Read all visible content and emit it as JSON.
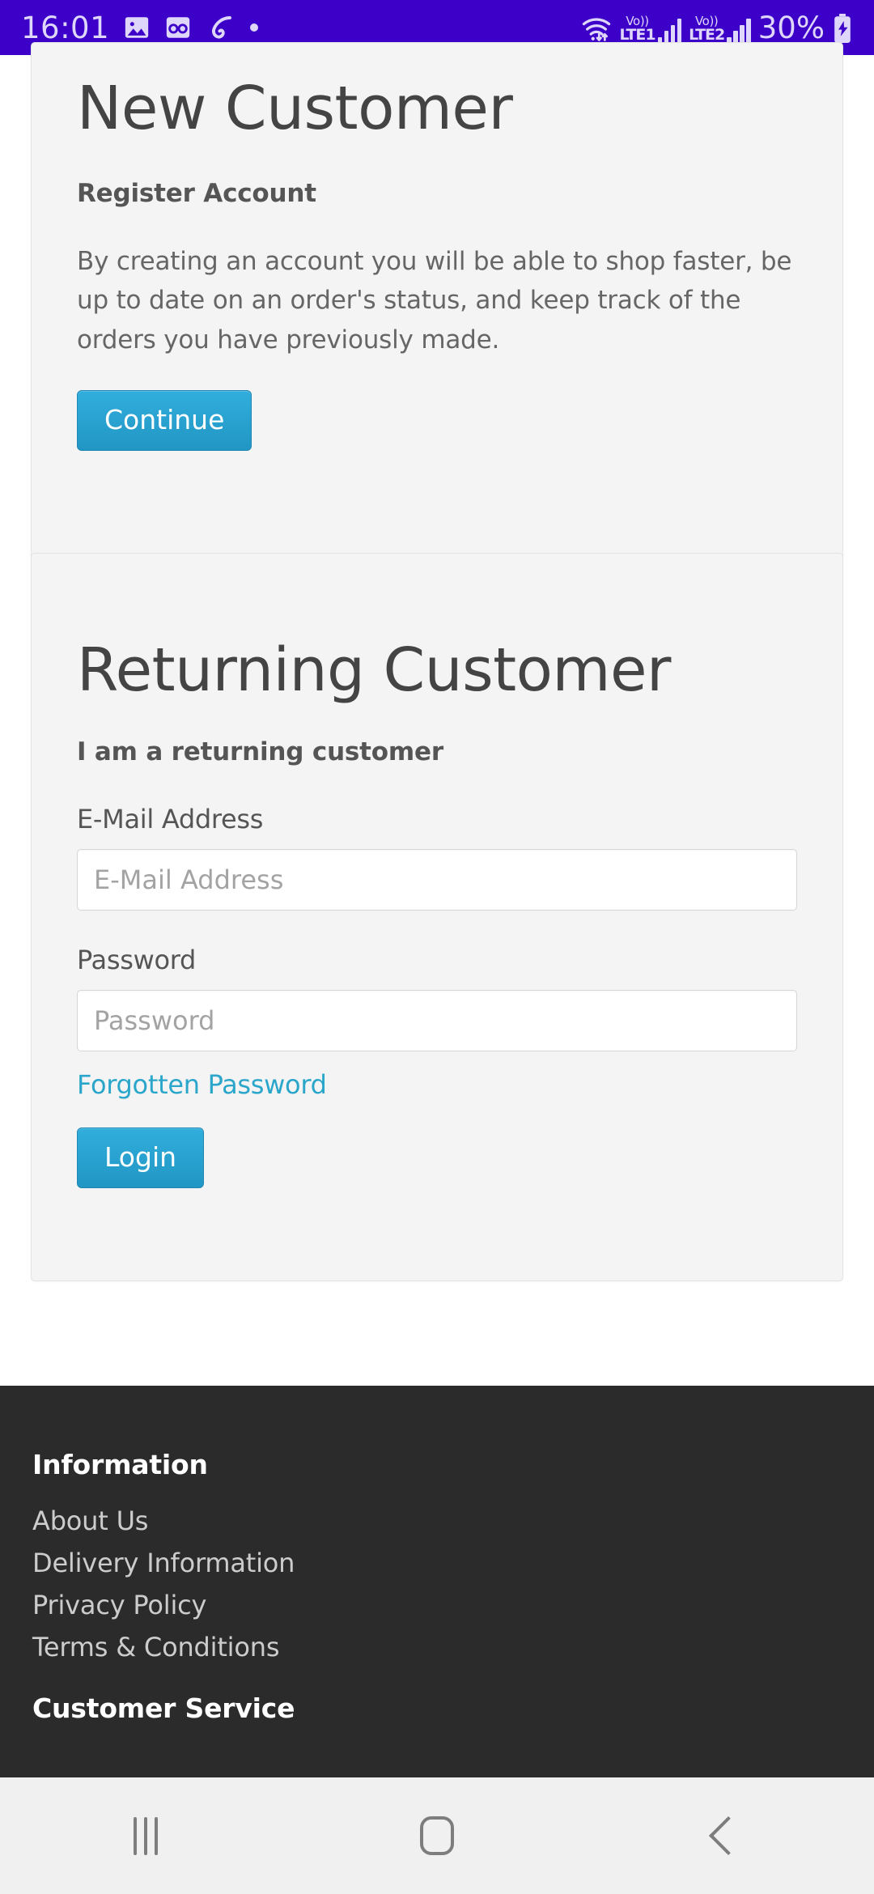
{
  "status_bar": {
    "time": "16:01",
    "left_icons": [
      "image-icon",
      "voicemail-icon",
      "airtel-swirl-icon",
      "dot-indicator-icon"
    ],
    "wifi_icon": "wifi-updown-icon",
    "sim1_vo": "Vo))",
    "sim1_lte": "LTE1",
    "sim2_vo": "Vo))",
    "sim2_lte": "LTE2",
    "battery_percent": "30%",
    "battery_icon": "battery-charging-icon",
    "background_color": "#3C00C8",
    "foreground_color": "#DED6FB"
  },
  "new_customer": {
    "title": "New Customer",
    "subtitle": "Register Account",
    "description": "By creating an account you will be able to shop faster, be up to date on an order's status, and keep track of the orders you have previously made.",
    "continue_label": "Continue"
  },
  "returning_customer": {
    "title": "Returning Customer",
    "subtitle": "I am a returning customer",
    "email_label": "E-Mail Address",
    "email_placeholder": "E-Mail Address",
    "email_value": "",
    "password_label": "Password",
    "password_placeholder": "Password",
    "password_value": "",
    "forgotten_password_label": "Forgotten Password",
    "login_label": "Login"
  },
  "footer": {
    "information_heading": "Information",
    "information_links": [
      "About Us",
      "Delivery Information",
      "Privacy Policy",
      "Terms & Conditions"
    ],
    "customer_service_heading": "Customer Service",
    "background_color": "#2B2B2B"
  },
  "nav_bar": {
    "recents_label": "recents-icon",
    "home_label": "home-icon",
    "back_label": "back-icon"
  },
  "theme": {
    "accent_blue": "#2BA6CB",
    "card_background": "#F4F4F4",
    "page_background": "#FFFFFF"
  }
}
